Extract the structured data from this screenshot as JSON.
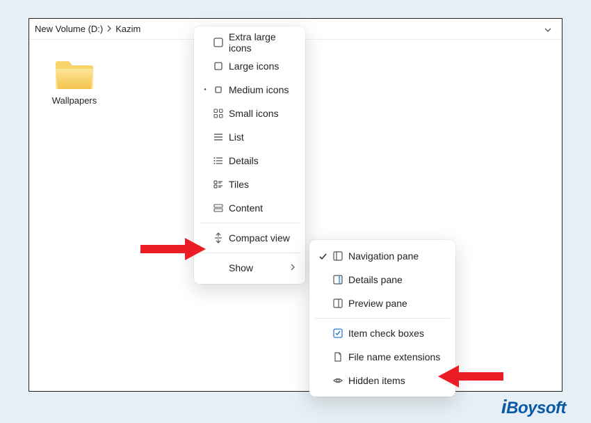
{
  "breadcrumbs": {
    "a": "New Volume (D:)",
    "b": "Kazim"
  },
  "folder": {
    "name": "Wallpapers"
  },
  "menu1": {
    "extra_large": "Extra large icons",
    "large": "Large icons",
    "medium": "Medium icons",
    "small": "Small icons",
    "list": "List",
    "details": "Details",
    "tiles": "Tiles",
    "content": "Content",
    "compact": "Compact view",
    "show": "Show"
  },
  "menu2": {
    "nav_pane": "Navigation pane",
    "details_pane": "Details pane",
    "preview_pane": "Preview pane",
    "item_check": "Item check boxes",
    "file_ext": "File name extensions",
    "hidden": "Hidden items"
  },
  "brand": "iBoysoft"
}
